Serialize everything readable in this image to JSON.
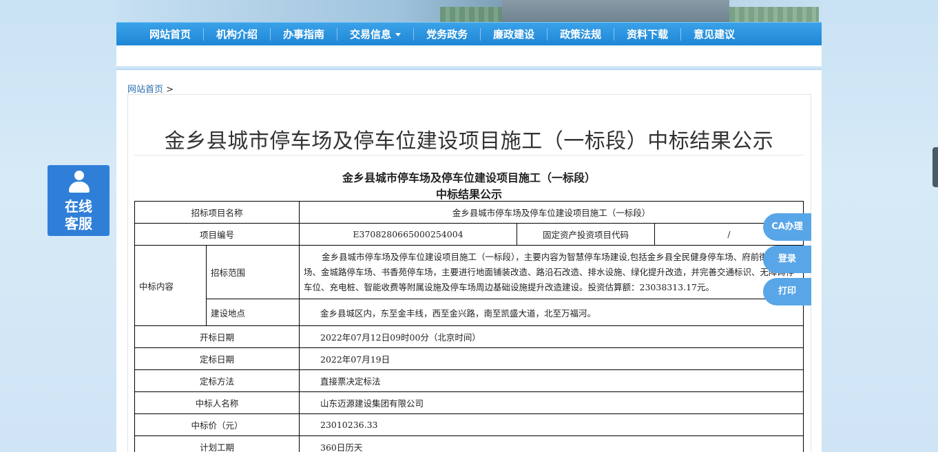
{
  "nav": {
    "items": [
      {
        "label": "网站首页"
      },
      {
        "label": "机构介绍"
      },
      {
        "label": "办事指南"
      },
      {
        "label": "交易信息",
        "has_dropdown": true
      },
      {
        "label": "党务政务"
      },
      {
        "label": "廉政建设"
      },
      {
        "label": "政策法规"
      },
      {
        "label": "资料下载"
      },
      {
        "label": "意见建议"
      }
    ]
  },
  "breadcrumb": {
    "home": "网站首页",
    "separator": ">"
  },
  "article": {
    "title": "金乡县城市停车场及停车位建设项目施工（一标段）中标结果公示",
    "subtitle_line1": "金乡县城市停车场及停车位建设项目施工（一标段）",
    "subtitle_line2": "中标结果公示"
  },
  "table": {
    "project_name_label": "招标项目名称",
    "project_name_value": "金乡县城市停车场及停车位建设项目施工（一标段）",
    "project_no_label": "项目编号",
    "project_no_value": "E3708280665000254004",
    "fixed_asset_label": "固定资产投资项目代码",
    "fixed_asset_value": "/",
    "content_label": "中标内容",
    "scope_label": "招标范围",
    "scope_value": "金乡县城市停车场及停车位建设项目施工（一标段），主要内容为智慧停车场建设,包括金乡县全民健身停车场、府前街停车场、金城路停车场、书香苑停车场，主要进行地面铺装改造、路沿石改造、排水设施、绿化提升改造，并完善交通标识、无障碍停车位、充电桩、智能收费等附属设施及停车场周边基础设施提升改造建设。投资估算额：23038313.17元。",
    "location_label": "建设地点",
    "location_value": "金乡县城区内，东至金丰线，西至金兴路，南至凯盛大道，北至万福河。",
    "open_date_label": "开标日期",
    "open_date_value": "2022年07月12日09时00分（北京时间）",
    "award_date_label": "定标日期",
    "award_date_value": "2022年07月19日",
    "method_label": "定标方法",
    "method_value": "直接票决定标法",
    "winner_label": "中标人名称",
    "winner_value": "山东迈源建设集团有限公司",
    "price_label": "中标价（元）",
    "price_value": "23010236.33",
    "period_label": "计划工期",
    "period_value": "360日历天"
  },
  "service": {
    "line1": "在线",
    "line2": "客服"
  },
  "side_buttons": {
    "ca": "CA办理",
    "login": "登录",
    "print": "打印"
  },
  "colors": {
    "nav_blue": "#1f86d6",
    "service_blue": "#2f7fd9",
    "side_button": "#58a6e8"
  }
}
